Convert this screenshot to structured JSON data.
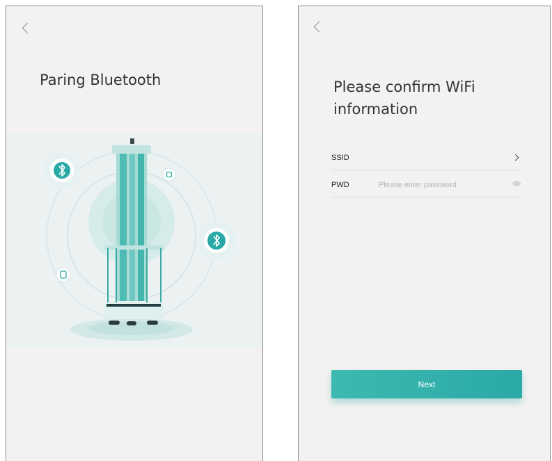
{
  "screen_bluetooth": {
    "title": "Paring Bluetooth",
    "icons": [
      "back-chevron-icon",
      "robot-illustration",
      "bluetooth-icon",
      "phone-device-icon",
      "small-device-icon"
    ]
  },
  "screen_wifi": {
    "title": "Please confirm WiFi information",
    "ssid_label": "SSID",
    "pwd_label": "PWD",
    "pwd_placeholder": "Please enter password",
    "next_label": "Next",
    "icons": [
      "back-chevron-icon",
      "chevron-right-icon",
      "eye-icon"
    ]
  },
  "colors": {
    "teal": "#2aa9a6",
    "teal_light": "#bfe5e2",
    "background": "#f3f2f1",
    "frame": "#8a8a8a"
  }
}
